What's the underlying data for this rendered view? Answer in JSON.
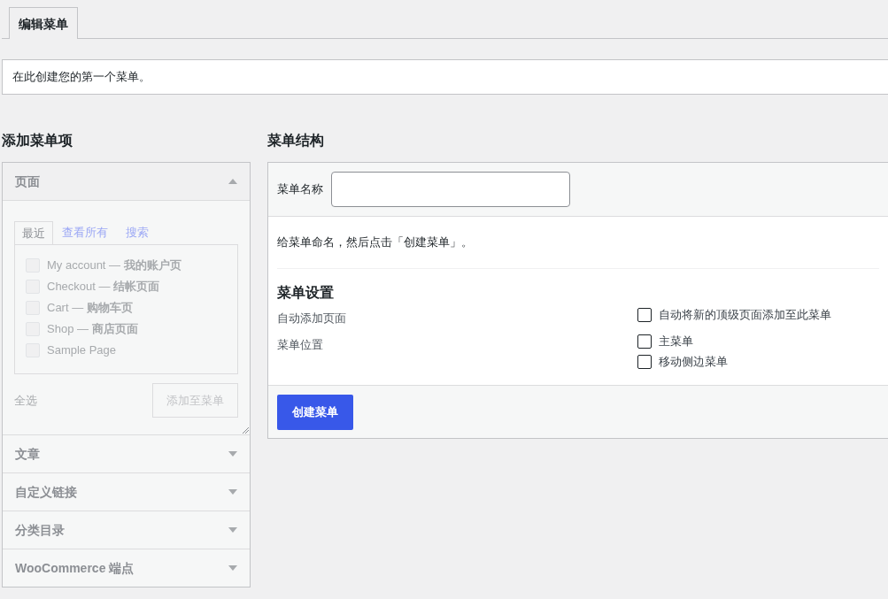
{
  "tabs": [
    {
      "label": "编辑菜单",
      "selected": true
    }
  ],
  "notice": "在此创建您的第一个菜单。",
  "add_items": {
    "title": "添加菜单项",
    "disabled": true,
    "sections": [
      {
        "title": "页面",
        "expanded": true,
        "tabs": [
          {
            "label": "最近",
            "selected": true
          },
          {
            "label": "查看所有",
            "selected": false
          },
          {
            "label": "搜索",
            "selected": false
          }
        ],
        "items": [
          {
            "label": "My account — **我的账户页**",
            "checked": false
          },
          {
            "label": "Checkout — **结帐页面**",
            "checked": false
          },
          {
            "label": "Cart — **购物车页**",
            "checked": false
          },
          {
            "label": "Shop — **商店页面**",
            "checked": false
          },
          {
            "label": "Sample Page",
            "checked": false
          }
        ],
        "select_all": "全选",
        "add_button": "添加至菜单"
      },
      {
        "title": "文章",
        "expanded": false
      },
      {
        "title": "自定义链接",
        "expanded": false
      },
      {
        "title": "分类目录",
        "expanded": false
      },
      {
        "title": "WooCommerce 端点",
        "expanded": false
      }
    ]
  },
  "structure": {
    "title": "菜单结构",
    "name_label": "菜单名称",
    "hint": "给菜单命名，然后点击「创建菜单」。",
    "settings_title": "菜单设置",
    "settings": [
      {
        "label": "自动添加页面",
        "options": [
          {
            "label": "自动将新的顶级页面添加至此菜单",
            "checked": false
          }
        ]
      },
      {
        "label": "菜单位置",
        "options": [
          {
            "label": "主菜单",
            "checked": false
          },
          {
            "label": "移动侧边菜单",
            "checked": false
          }
        ]
      }
    ],
    "create_button": "创建菜单"
  }
}
